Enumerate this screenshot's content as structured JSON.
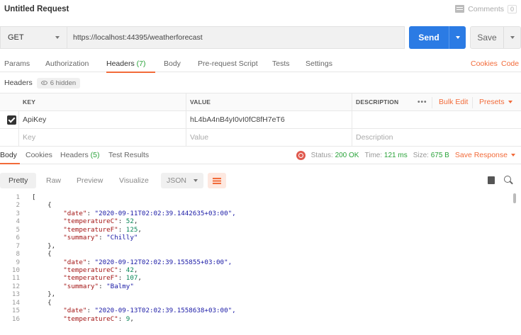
{
  "request": {
    "title": "Untitled Request",
    "comments_label": "Comments",
    "comments_count": "0",
    "method": "GET",
    "url": "https://localhost:44395/weatherforecast",
    "send_label": "Send",
    "save_label": "Save"
  },
  "req_tabs": {
    "params": "Params",
    "authorization": "Authorization",
    "headers": "Headers",
    "headers_count": "(7)",
    "body": "Body",
    "prerequest": "Pre-request Script",
    "tests": "Tests",
    "settings": "Settings",
    "cookies": "Cookies",
    "code": "Code"
  },
  "headers_section": {
    "label": "Headers",
    "hidden": "6 hidden",
    "col_key": "KEY",
    "col_value": "VALUE",
    "col_description": "DESCRIPTION",
    "more": "•••",
    "bulk_edit": "Bulk Edit",
    "presets": "Presets",
    "rows": [
      {
        "key": "ApiKey",
        "value": "hL4bA4nB4yI0vI0fC8fH7eT6",
        "description": ""
      }
    ],
    "placeholder_key": "Key",
    "placeholder_value": "Value",
    "placeholder_description": "Description"
  },
  "resp_tabs": {
    "body": "Body",
    "cookies": "Cookies",
    "headers": "Headers",
    "headers_count": "(5)",
    "test_results": "Test Results",
    "status_label": "Status:",
    "status_value": "200 OK",
    "time_label": "Time:",
    "time_value": "121 ms",
    "size_label": "Size:",
    "size_value": "675 B",
    "save_response": "Save Response"
  },
  "view": {
    "pretty": "Pretty",
    "raw": "Raw",
    "preview": "Preview",
    "visualize": "Visualize",
    "format": "JSON"
  },
  "code_lines": [
    {
      "n": "1",
      "t": "["
    },
    {
      "n": "2",
      "t": "    {"
    },
    {
      "n": "3",
      "t": "        \"date\": \"2020-09-11T02:02:39.1442635+03:00\","
    },
    {
      "n": "4",
      "t": "        \"temperatureC\": 52,"
    },
    {
      "n": "5",
      "t": "        \"temperatureF\": 125,"
    },
    {
      "n": "6",
      "t": "        \"summary\": \"Chilly\""
    },
    {
      "n": "7",
      "t": "    },"
    },
    {
      "n": "8",
      "t": "    {"
    },
    {
      "n": "9",
      "t": "        \"date\": \"2020-09-12T02:02:39.155855+03:00\","
    },
    {
      "n": "10",
      "t": "        \"temperatureC\": 42,"
    },
    {
      "n": "11",
      "t": "        \"temperatureF\": 107,"
    },
    {
      "n": "12",
      "t": "        \"summary\": \"Balmy\""
    },
    {
      "n": "13",
      "t": "    },"
    },
    {
      "n": "14",
      "t": "    {"
    },
    {
      "n": "15",
      "t": "        \"date\": \"2020-09-13T02:02:39.1558638+03:00\","
    },
    {
      "n": "16",
      "t": "        \"temperatureC\": 9,"
    }
  ],
  "colors": {
    "accent": "#f26b3a",
    "send": "#2b7be4",
    "ok": "#2aa33a"
  }
}
